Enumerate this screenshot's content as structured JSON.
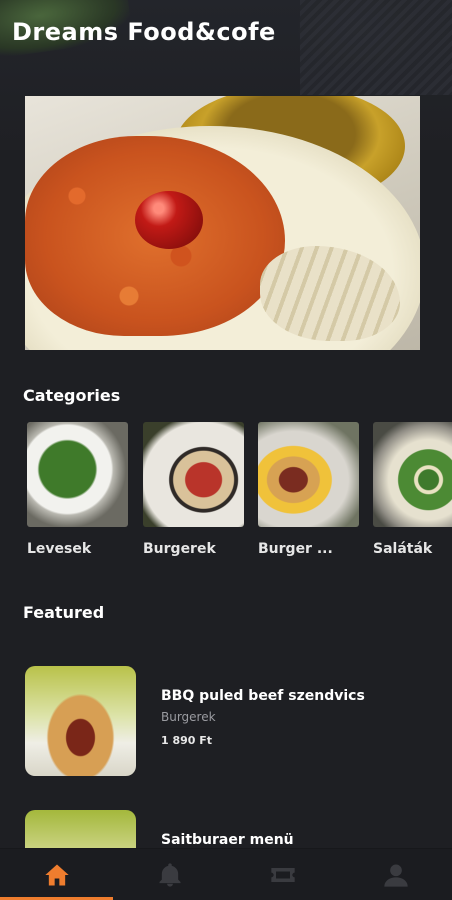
{
  "app": {
    "title": "Dreams Food&cofe"
  },
  "hero": {
    "image": "featured-dish-photo"
  },
  "categories": {
    "title": "Categories",
    "items": [
      {
        "label": "Levesek",
        "image": "soup-photo"
      },
      {
        "label": "Burgerek",
        "image": "burger-photo"
      },
      {
        "label": "Burger ...",
        "image": "burger-menu-photo"
      },
      {
        "label": "Saláták",
        "image": "salad-photo"
      }
    ]
  },
  "featured": {
    "title": "Featured",
    "items": [
      {
        "name": "BBQ puled beef szendvics",
        "category": "Burgerek",
        "price": "1 890 Ft",
        "image": "sandwich-photo"
      },
      {
        "name": "Saitburaer menü",
        "category": "",
        "price": "",
        "image": "burger-menu-photo"
      }
    ]
  },
  "bottom_nav": {
    "items": [
      {
        "icon": "home-icon",
        "active": true
      },
      {
        "icon": "bell-icon",
        "active": false
      },
      {
        "icon": "ticket-icon",
        "active": false
      },
      {
        "icon": "user-icon",
        "active": false
      }
    ],
    "active_color": "#ef7d2e",
    "inactive_color": "#3a3b40"
  },
  "colors": {
    "background": "#1e1f23",
    "accent": "#ef7d2e"
  }
}
